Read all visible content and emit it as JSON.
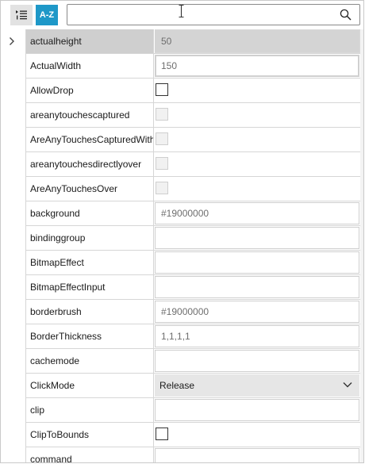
{
  "toolbar": {
    "categorized_icon": "categorized-list-icon",
    "sort_label": "A-Z",
    "search_placeholder": "",
    "search_icon": "search-icon"
  },
  "properties": [
    {
      "name": "actualheight",
      "value": "50",
      "editor": "text-readonly",
      "selected": true
    },
    {
      "name": "ActualWidth",
      "value": "150",
      "editor": "text-readonly"
    },
    {
      "name": "AllowDrop",
      "value": "",
      "editor": "checkbox"
    },
    {
      "name": "areanytouchescaptured",
      "value": "",
      "editor": "checkbox-disabled"
    },
    {
      "name": "AreAnyTouchesCapturedWithin",
      "value": "",
      "editor": "checkbox-disabled"
    },
    {
      "name": "areanytouchesdirectlyover",
      "value": "",
      "editor": "checkbox-disabled"
    },
    {
      "name": "AreAnyTouchesOver",
      "value": "",
      "editor": "checkbox-disabled"
    },
    {
      "name": "background",
      "value": "#19000000",
      "editor": "text"
    },
    {
      "name": "bindinggroup",
      "value": "",
      "editor": "text"
    },
    {
      "name": "BitmapEffect",
      "value": "",
      "editor": "text"
    },
    {
      "name": "BitmapEffectInput",
      "value": "",
      "editor": "text"
    },
    {
      "name": "borderbrush",
      "value": "#19000000",
      "editor": "text"
    },
    {
      "name": "BorderThickness",
      "value": "1,1,1,1",
      "editor": "text"
    },
    {
      "name": "cachemode",
      "value": "",
      "editor": "text"
    },
    {
      "name": "ClickMode",
      "value": "Release",
      "editor": "combo"
    },
    {
      "name": "clip",
      "value": "",
      "editor": "text"
    },
    {
      "name": "ClipToBounds",
      "value": "",
      "editor": "checkbox"
    },
    {
      "name": "command",
      "value": "",
      "editor": "text"
    }
  ],
  "colors": {
    "accent": "#1e98c8",
    "selected_row": "#cfcfcf",
    "border": "#d6d6d6"
  }
}
